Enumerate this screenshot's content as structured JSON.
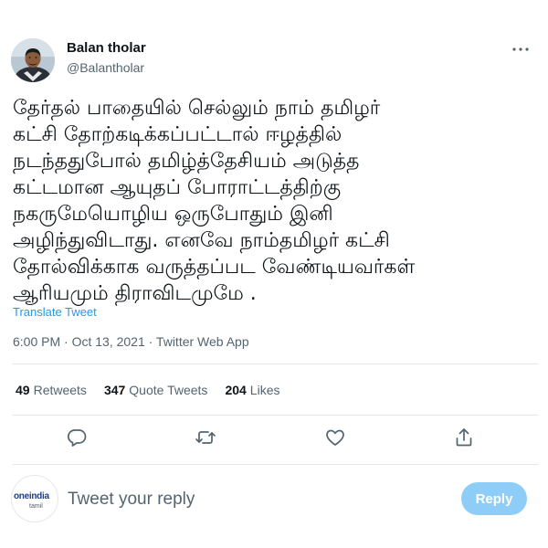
{
  "author": {
    "name": "Balan tholar",
    "handle": "@Balantholar"
  },
  "tweet": {
    "text": "தேர்தல் பாதையில் செல்லும் நாம் தமிழர்\nகட்சி தோற்கடிக்கப்பட்டால் ஈழத்தில்\nநடந்ததுபோல் தமிழ்த்தேசியம் அடுத்த\nகட்டமான ஆயுதப் போராட்டத்திற்கு\nநகருமேயொழிய ஒருபோதும் இனி\nஅழிந்துவிடாது. எனவே நாம்தமிழர் கட்சி\nதோல்விக்காக வருத்தப்பட வேண்டியவர்கள்\nஆரியமும் திராவிடமுமே .",
    "translate_label": "Translate Tweet",
    "timestamp": "6:00 PM · Oct 13, 2021 · Twitter Web App"
  },
  "stats": {
    "retweets_count": "49",
    "retweets_label": "Retweets",
    "quote_count": "347",
    "quote_label": "Quote Tweets",
    "likes_count": "204",
    "likes_label": "Likes"
  },
  "actions": {
    "icons": [
      "reply-icon",
      "retweet-icon",
      "like-icon",
      "share-icon"
    ]
  },
  "reply_box": {
    "placeholder": "Tweet your reply",
    "button_label": "Reply",
    "avatar_logo_main": "oneindia",
    "avatar_logo_sub": "tamil"
  },
  "colors": {
    "accent": "#1d9bf0",
    "reply_button_disabled": "#8ecdf8",
    "secondary_text": "#536471",
    "divider": "#e3e8ec"
  }
}
